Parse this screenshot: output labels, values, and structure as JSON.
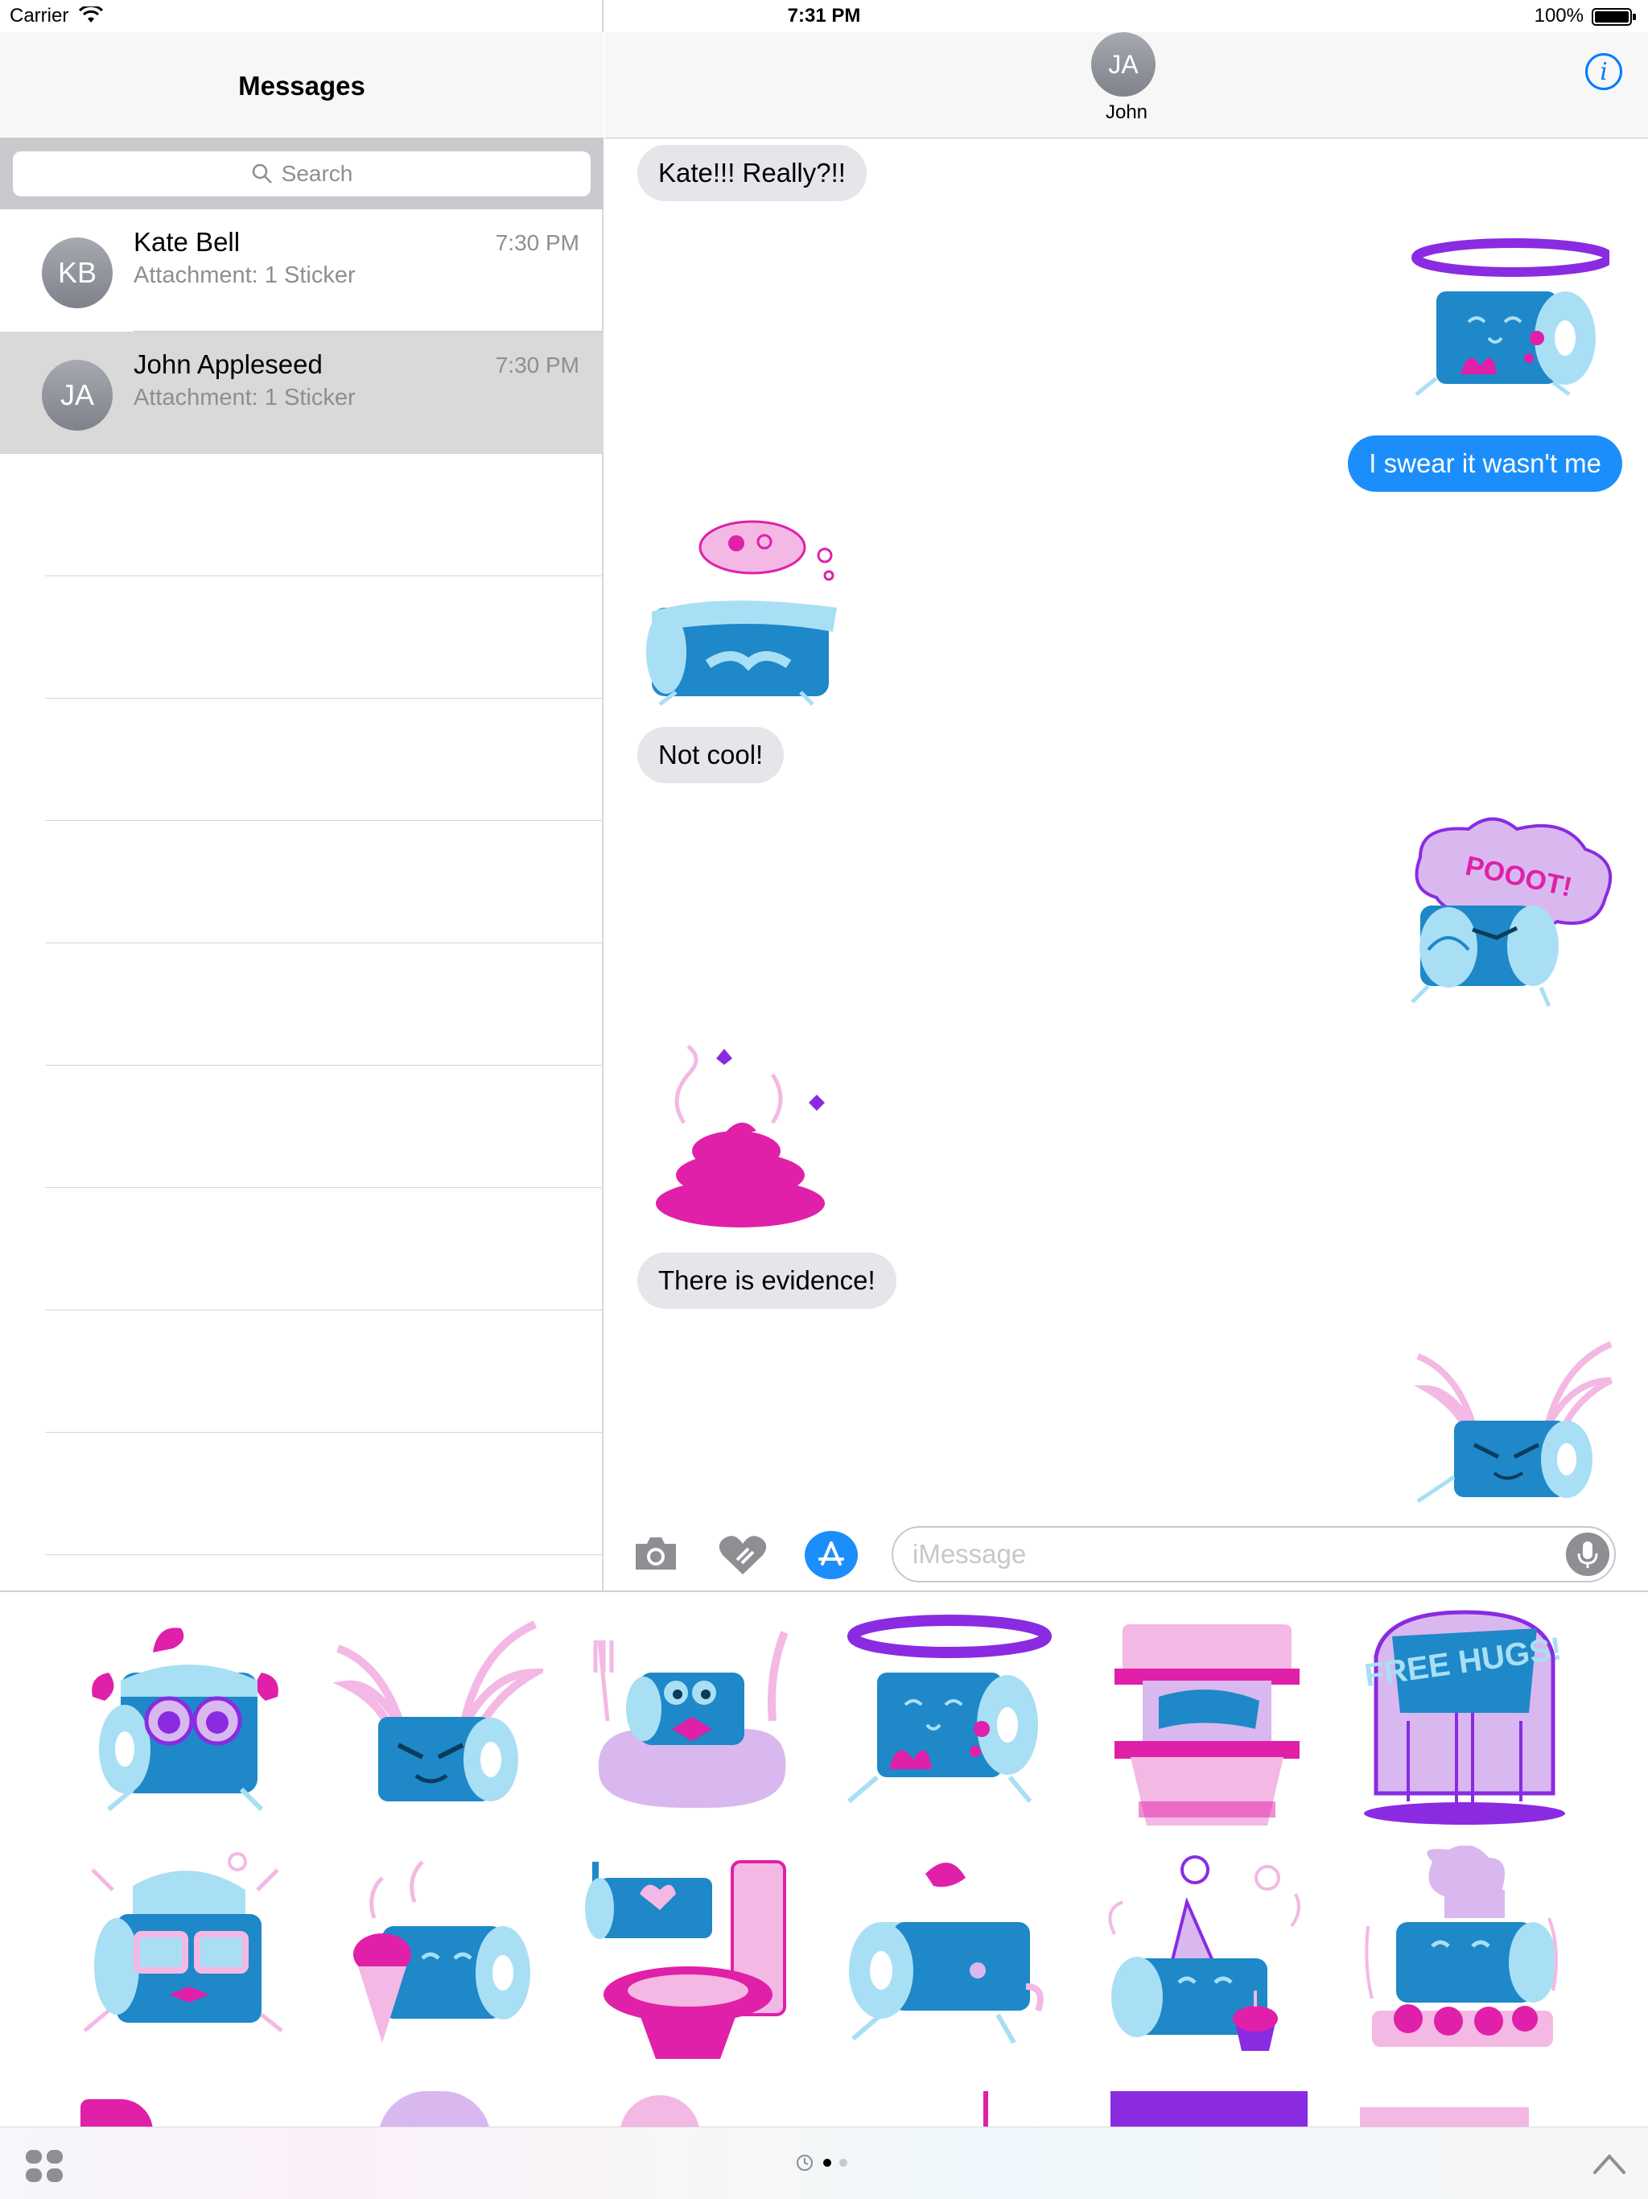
{
  "status_bar": {
    "carrier": "Carrier",
    "time": "7:31 PM",
    "battery": "100%"
  },
  "sidebar": {
    "title": "Messages",
    "search_placeholder": "Search",
    "conversations": [
      {
        "initials": "KB",
        "name": "Kate Bell",
        "time": "7:30 PM",
        "preview": "Attachment: 1 Sticker",
        "selected": false
      },
      {
        "initials": "JA",
        "name": "John Appleseed",
        "time": "7:30 PM",
        "preview": "Attachment: 1 Sticker",
        "selected": true
      }
    ]
  },
  "conversation": {
    "contact_initials": "JA",
    "contact_name": "John",
    "info_icon": "info-icon",
    "messages": [
      {
        "direction": "incoming",
        "type": "text",
        "text": "Kate!!! Really?!!"
      },
      {
        "direction": "outgoing",
        "type": "sticker",
        "sticker": "halo-roll"
      },
      {
        "direction": "outgoing",
        "type": "text",
        "text": "I swear it wasn't me"
      },
      {
        "direction": "incoming",
        "type": "sticker",
        "sticker": "dreaming-roll"
      },
      {
        "direction": "incoming",
        "type": "text",
        "text": "Not cool!"
      },
      {
        "direction": "outgoing",
        "type": "sticker",
        "sticker": "pooot-roll",
        "sticker_text": "POOOT!"
      },
      {
        "direction": "incoming",
        "type": "sticker",
        "sticker": "poop"
      },
      {
        "direction": "incoming",
        "type": "text",
        "text": "There is evidence!"
      },
      {
        "direction": "outgoing",
        "type": "sticker",
        "sticker": "winged-roll"
      }
    ],
    "input_placeholder": "iMessage"
  },
  "drawer": {
    "stickers": [
      {
        "name": "surprised-roll"
      },
      {
        "name": "winged-roll"
      },
      {
        "name": "roll-with-fork-and-knife"
      },
      {
        "name": "halo-roll"
      },
      {
        "name": "roll-in-toilet"
      },
      {
        "name": "free-hugs-roll",
        "text": "FREE HUGS!"
      },
      {
        "name": "nerd-roll"
      },
      {
        "name": "ice-cream-roll"
      },
      {
        "name": "toilet-love-roll"
      },
      {
        "name": "sneaky-roll"
      },
      {
        "name": "party-roll"
      },
      {
        "name": "chef-roll"
      }
    ]
  },
  "colors": {
    "accent": "#1c8efb",
    "sticker_blue": "#1e88c8",
    "sticker_light_blue": "#a9dff5",
    "sticker_magenta": "#e020a8",
    "sticker_pink": "#f4b8e4",
    "sticker_purple": "#8a2be2",
    "sticker_lavender": "#d9b8f0"
  }
}
